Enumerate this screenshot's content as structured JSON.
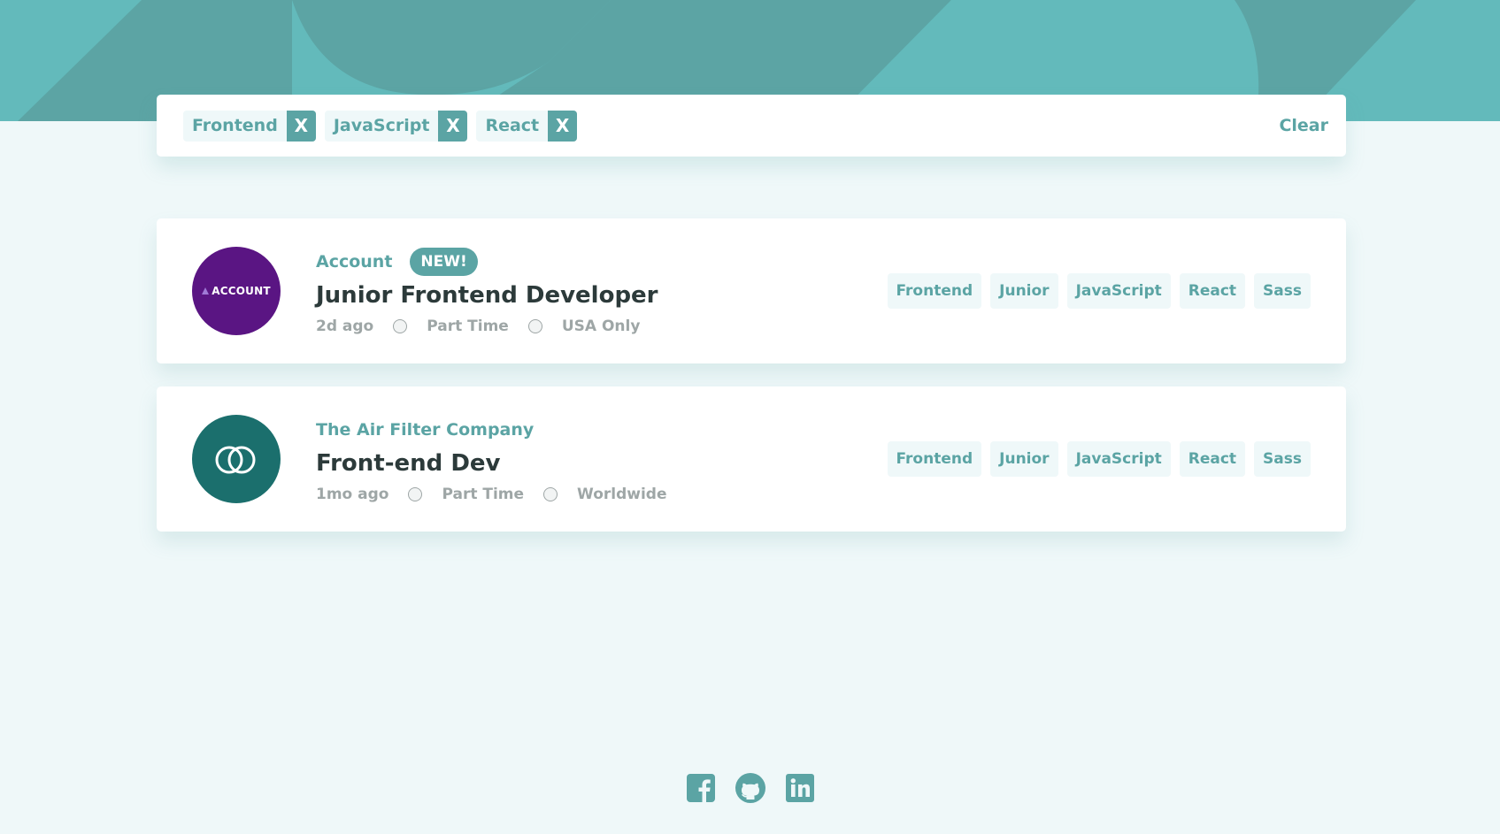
{
  "filters": {
    "chips": [
      {
        "label": "Frontend",
        "remove": "X"
      },
      {
        "label": "JavaScript",
        "remove": "X"
      },
      {
        "label": "React",
        "remove": "X"
      }
    ],
    "clear_label": "Clear"
  },
  "jobs": [
    {
      "company": "Account",
      "logo_text": "ACCOUNT",
      "badge": "NEW!",
      "title": "Junior Frontend Developer",
      "posted": "2d ago",
      "contract": "Part Time",
      "location": "USA Only",
      "tags": [
        "Frontend",
        "Junior",
        "JavaScript",
        "React",
        "Sass"
      ]
    },
    {
      "company": "The Air Filter Company",
      "title": "Front-end Dev",
      "posted": "1mo ago",
      "contract": "Part Time",
      "location": "Worldwide",
      "tags": [
        "Frontend",
        "Junior",
        "JavaScript",
        "React",
        "Sass"
      ]
    }
  ],
  "footer": {
    "icons": [
      "facebook-icon",
      "github-icon",
      "linkedin-icon"
    ]
  },
  "colors": {
    "primary": "#5ba4a4",
    "header": "#63babb",
    "background": "#eff8f9",
    "title": "#2c3a3a",
    "meta": "#9ea6a6"
  }
}
